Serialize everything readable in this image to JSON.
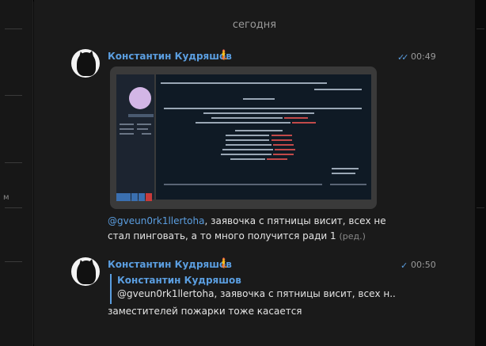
{
  "date_separator": "сегодня",
  "messages": [
    {
      "author": "Константин Кудряшов",
      "emoji": "🧜",
      "time": "00:49",
      "check": "✓✓",
      "mention": "@gveun0rk1llertoha",
      "text_line1": ", заявочка с пятницы висит, всех не",
      "text_line2": "стал пинговать, а то много получится ради 1",
      "edited": "(ред.)"
    },
    {
      "author": "Константин Кудряшов",
      "emoji": "🧜",
      "time": "00:50",
      "check": "✓",
      "reply_author": "Константин Кудряшов",
      "reply_text": "@gveun0rk1llertoha, заявочка с пятницы висит, всех н...",
      "text": "заместителей пожарки тоже касается"
    }
  ],
  "icons": [
    "cat-avatar-icon",
    "mermaid-emoji-icon",
    "double-check-icon",
    "single-check-icon"
  ],
  "colors": {
    "accent": "#5b9ee0",
    "background": "#1a1a1a",
    "text": "#e4e4e4",
    "muted": "#9a9a9a"
  }
}
